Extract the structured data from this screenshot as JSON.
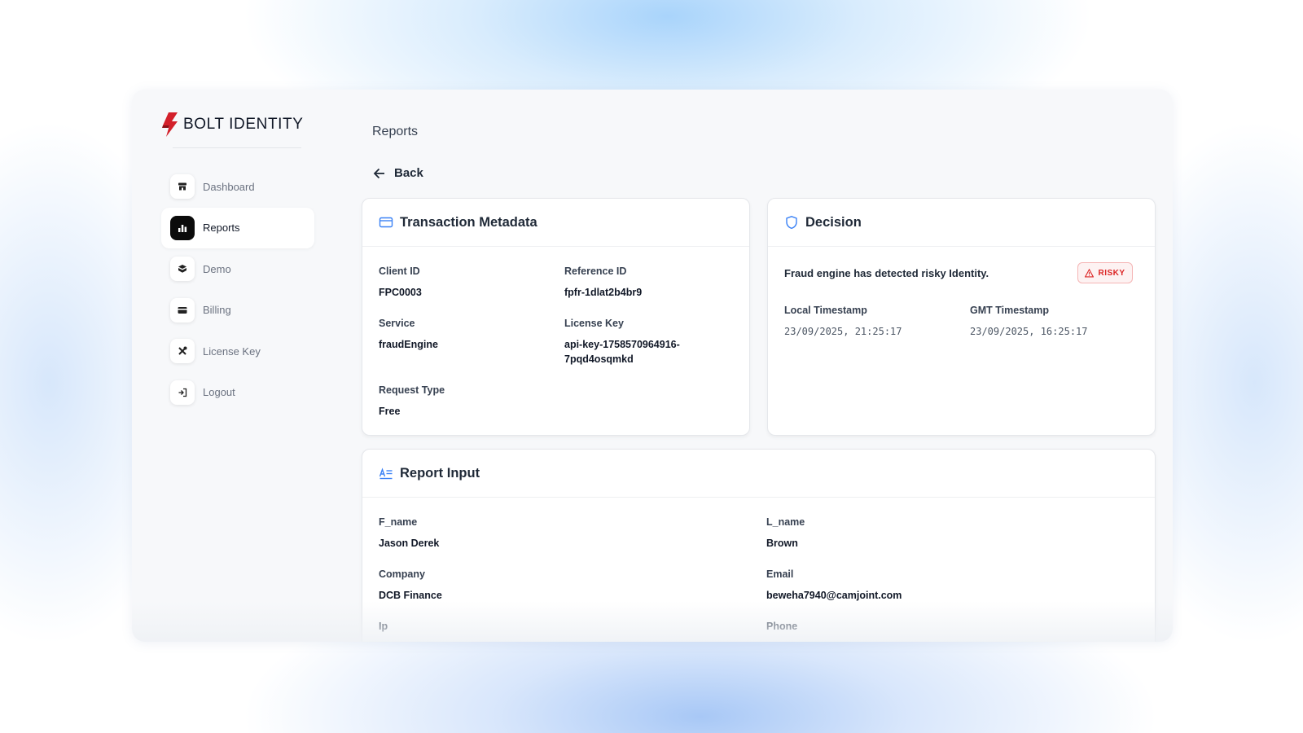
{
  "app": {
    "brand": "BOLT IDENTITY"
  },
  "colors": {
    "brand_red": "#d3202a",
    "accent_blue": "#3b82f6",
    "risk_red": "#dc2626"
  },
  "sidebar": {
    "items": [
      {
        "label": "Dashboard",
        "icon": "store-icon",
        "active": false
      },
      {
        "label": "Reports",
        "icon": "bar-chart-icon",
        "active": true
      },
      {
        "label": "Demo",
        "icon": "cube-icon",
        "active": false
      },
      {
        "label": "Billing",
        "icon": "credit-card-icon",
        "active": false
      },
      {
        "label": "License Key",
        "icon": "tools-icon",
        "active": false
      },
      {
        "label": "Logout",
        "icon": "logout-icon",
        "active": false
      }
    ]
  },
  "header": {
    "title": "Reports",
    "back_label": "Back"
  },
  "transaction": {
    "title": "Transaction Metadata",
    "client_id_label": "Client ID",
    "client_id": "FPC0003",
    "reference_id_label": "Reference ID",
    "reference_id": "fpfr-1dlat2b4br9",
    "service_label": "Service",
    "service": "fraudEngine",
    "license_key_label": "License Key",
    "license_key_line1": "api-key-1758570964916-",
    "license_key_line2": "7pqd4osqmkd",
    "request_type_label": "Request Type",
    "request_type": "Free"
  },
  "decision": {
    "title": "Decision",
    "message": "Fraud engine has detected risky Identity.",
    "badge": "RISKY",
    "local_label": "Local Timestamp",
    "local_value": "23/09/2025, 21:25:17",
    "gmt_label": "GMT Timestamp",
    "gmt_value": "23/09/2025, 16:25:17"
  },
  "report_input": {
    "title": "Report Input",
    "f_name_label": "F_name",
    "f_name": "Jason Derek",
    "l_name_label": "L_name",
    "l_name": "Brown",
    "company_label": "Company",
    "company": "DCB Finance",
    "email_label": "Email",
    "email": "beweha7940@camjoint.com",
    "ip_label": "Ip",
    "phone_label": "Phone"
  }
}
